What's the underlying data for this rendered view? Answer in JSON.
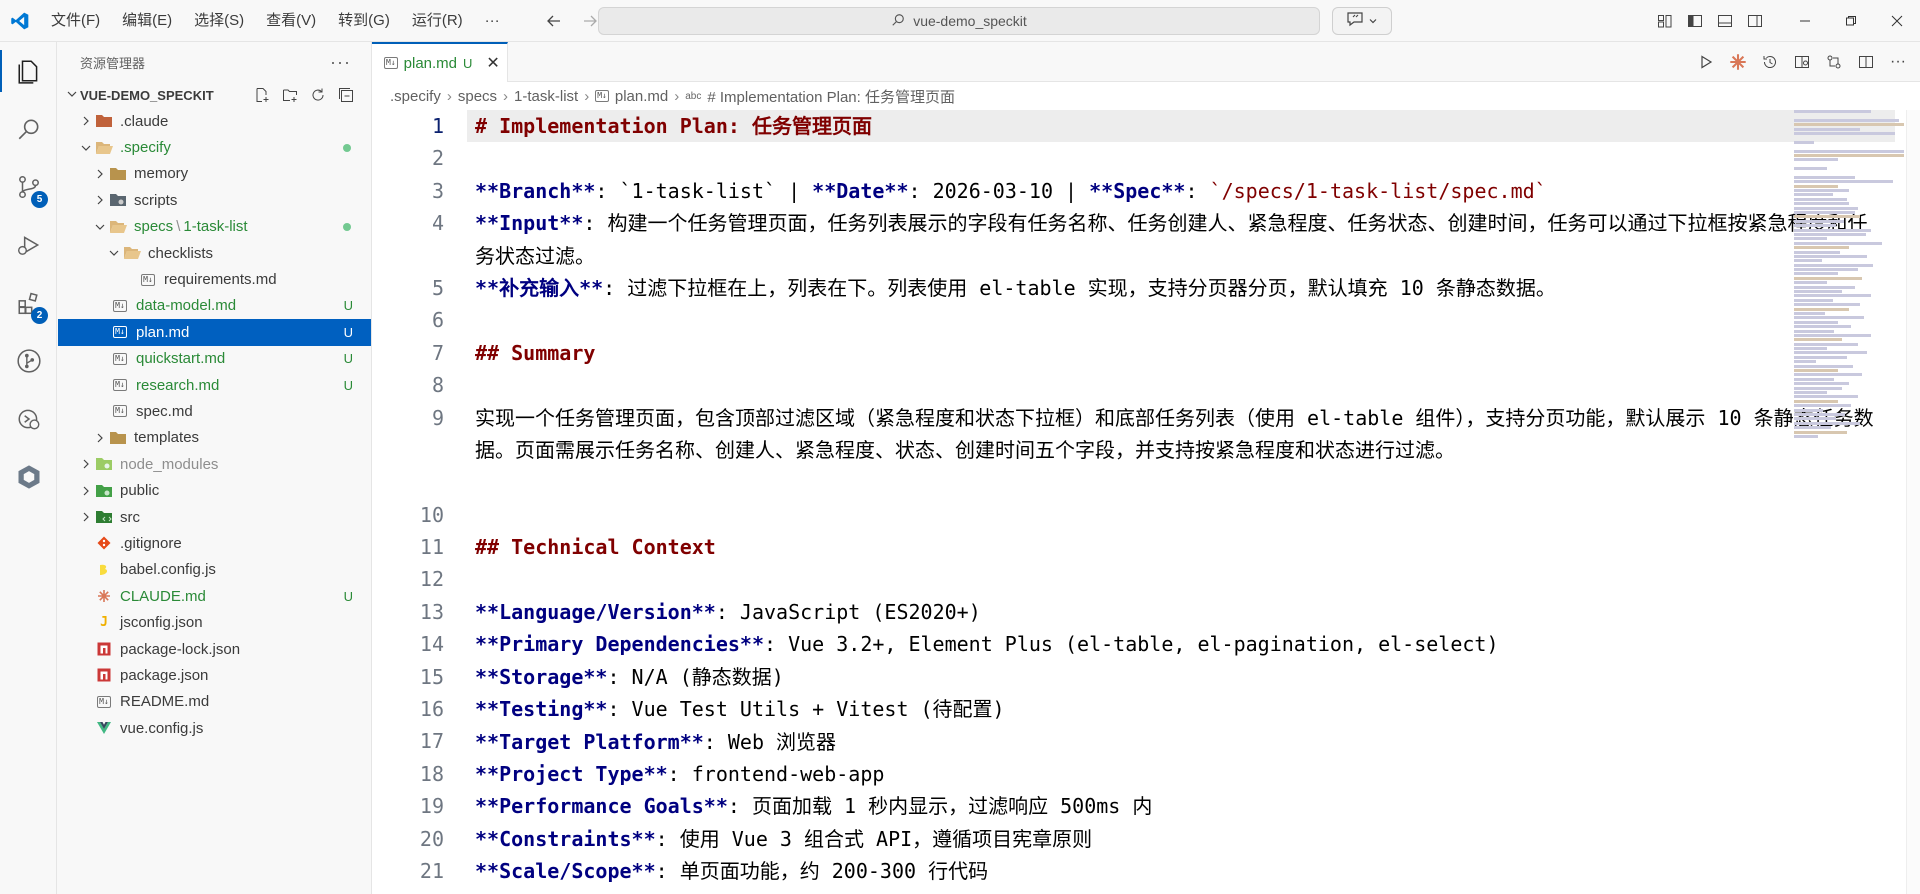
{
  "menu": [
    "文件(F)",
    "编辑(E)",
    "选择(S)",
    "查看(V)",
    "转到(G)",
    "运行(R)",
    "···"
  ],
  "search": {
    "text": "vue-demo_speckit"
  },
  "activity": {
    "scm_badge": "5",
    "extensions_badge": "2"
  },
  "sidebar": {
    "title": "资源管理器",
    "more": "···",
    "project": "VUE-DEMO_SPECKIT",
    "items": [
      {
        "label": ".claude",
        "icon": "folder-icon"
      },
      {
        "label": ".specify",
        "icon": "folder-open-icon"
      },
      {
        "label": "memory",
        "icon": "folder-icon"
      },
      {
        "label": "scripts",
        "icon": "folder-icon"
      },
      {
        "label": "specs",
        "sep": "\\",
        "label2": "1-task-list",
        "icon": "folder-open-icon"
      },
      {
        "label": "checklists",
        "icon": "folder-open-icon"
      },
      {
        "label": "requirements.md",
        "icon": "markdown-icon"
      },
      {
        "label": "data-model.md",
        "icon": "markdown-icon",
        "status": "U"
      },
      {
        "label": "plan.md",
        "icon": "markdown-icon",
        "status": "U"
      },
      {
        "label": "quickstart.md",
        "icon": "markdown-icon",
        "status": "U"
      },
      {
        "label": "research.md",
        "icon": "markdown-icon",
        "status": "U"
      },
      {
        "label": "spec.md",
        "icon": "markdown-icon"
      },
      {
        "label": "templates",
        "icon": "folder-icon"
      },
      {
        "label": "node_modules",
        "icon": "folder-icon"
      },
      {
        "label": "public",
        "icon": "folder-icon"
      },
      {
        "label": "src",
        "icon": "folder-icon"
      },
      {
        "label": ".gitignore",
        "icon": "git-icon"
      },
      {
        "label": "babel.config.js",
        "icon": "babel-icon"
      },
      {
        "label": "CLAUDE.md",
        "icon": "claude-icon",
        "status": "U"
      },
      {
        "label": "jsconfig.json",
        "icon": "json-icon"
      },
      {
        "label": "package-lock.json",
        "icon": "npm-icon"
      },
      {
        "label": "package.json",
        "icon": "npm-icon"
      },
      {
        "label": "README.md",
        "icon": "markdown-icon"
      },
      {
        "label": "vue.config.js",
        "icon": "vue-icon"
      }
    ]
  },
  "tab": {
    "name": "plan.md",
    "status": "U",
    "close": "✕"
  },
  "breadcrumb": [
    ".specify",
    "specs",
    "1-task-list",
    "plan.md",
    "# Implementation Plan: 任务管理页面"
  ],
  "editor": {
    "line_numbers": [
      "1",
      "2",
      "3",
      "4",
      "",
      "5",
      "6",
      "7",
      "8",
      "9",
      "",
      "",
      "10",
      "11",
      "12",
      "13",
      "14",
      "15",
      "16",
      "17",
      "18",
      "19",
      "20",
      "21"
    ],
    "lines": {
      "l1": "# Implementation Plan: 任务管理页面",
      "l3a": "**Branch**",
      "l3b": ": `1-task-list` | ",
      "l3c": "**Date**",
      "l3d": ": 2026-03-10 | ",
      "l3e": "**Spec**",
      "l3f": ": ",
      "l3g": "`/specs/1-task-list/spec.md`",
      "l4a": "**Input**",
      "l4b": ": 构建一个任务管理页面，任务列表展示的字段有任务名称、任务创建人、紧急程度、任务状态、创建时间，任务可以通过下拉框按紧急程度和任务状态过滤。",
      "l5a": "**补充输入**",
      "l5b": ": 过滤下拉框在上，列表在下。列表使用 el-table 实现，支持分页器分页，默认填充 10 条静态数据。",
      "l7": "## Summary",
      "l9": "实现一个任务管理页面，包含顶部过滤区域（紧急程度和状态下拉框）和底部任务列表（使用 el-table 组件），支持分页功能，默认展示 10 条静态任务数据。页面需展示任务名称、创建人、紧急程度、状态、创建时间五个字段，并支持按紧急程度和状态进行过滤。",
      "l11": "## Technical Context",
      "l13a": "**Language/Version**",
      "l13b": ": JavaScript (ES2020+)",
      "l14a": "**Primary Dependencies**",
      "l14b": ": Vue 3.2+, Element Plus (el-table, el-pagination, el-select)",
      "l15a": "**Storage**",
      "l15b": ": N/A (静态数据)",
      "l16a": "**Testing**",
      "l16b": ": Vue Test Utils + Vitest (待配置)",
      "l17a": "**Target Platform**",
      "l17b": ": Web 浏览器",
      "l18a": "**Project Type**",
      "l18b": ": frontend-web-app",
      "l19a": "**Performance Goals**",
      "l19b": ": 页面加载 1 秒内显示，过滤响应 500ms 内",
      "l20a": "**Constraints**",
      "l20b": ": 使用 Vue 3 组合式 API，遵循项目宪章原则",
      "l21a": "**Scale/Scope**",
      "l21b": ": 单页面功能，约 200-300 行代码"
    }
  },
  "colors": {
    "accent": "#005fb8",
    "selection": "#0060c0",
    "git_untracked": "#2a8a37",
    "heading": "#800000",
    "bold": "#000080"
  }
}
